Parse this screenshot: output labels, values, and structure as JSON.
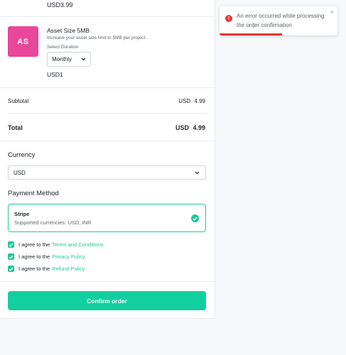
{
  "cart": {
    "prev_item_price": "USD3.99",
    "item": {
      "avatar_text": "AS",
      "name": "Asset Size 5MB",
      "description": "Increase your asset size limit to 5MB per project.",
      "duration_label": "Select Duration",
      "duration_value": "Monthly",
      "price": "USD1"
    },
    "subtotal_label": "Subtotal",
    "subtotal_value": "USD  4.99",
    "total_label": "Total",
    "total_value": "USD  4.99"
  },
  "currency": {
    "title": "Currency",
    "selected": "USD"
  },
  "payment": {
    "title": "Payment Method",
    "method_name": "Stripe",
    "method_sub": "Supported currencies: USD, INR"
  },
  "agreements": [
    {
      "prefix": "I agree to the",
      "link": "Terms and Conditions"
    },
    {
      "prefix": "I agree to the",
      "link": "Privacy Policy"
    },
    {
      "prefix": "I agree to the",
      "link": "Refund Policy"
    }
  ],
  "confirm_label": "Confirm order",
  "toast": {
    "message": "An error occurred while processing the order confirmation",
    "icon": "error-icon",
    "close_icon": "close-icon"
  },
  "colors": {
    "accent": "#13cf9f",
    "avatar": "#e8479a",
    "error": "#e53935"
  }
}
